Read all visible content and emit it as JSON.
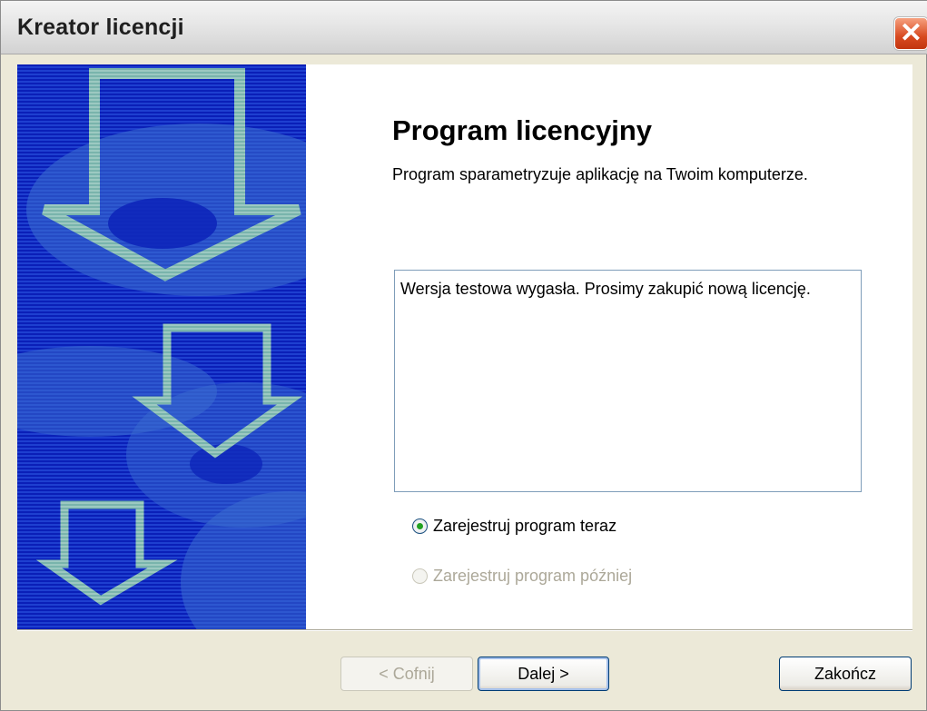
{
  "window": {
    "title": "Kreator licencji",
    "close_glyph": "✕"
  },
  "icons": {
    "close": "close-icon",
    "banner": "download-arrows-icon"
  },
  "page": {
    "heading": "Program licencyjny",
    "description": "Program sparametryzuje aplikację na Twoim komputerze.",
    "message": "Wersja testowa wygasła. Prosimy zakupić nową licencję."
  },
  "options": [
    {
      "label": "Zarejestruj program teraz",
      "selected": true,
      "enabled": true
    },
    {
      "label": "Zarejestruj program później",
      "selected": false,
      "enabled": false
    }
  ],
  "buttons": {
    "back": "< Cofnij",
    "next": "Dalej >",
    "finish": "Zakończ"
  },
  "colors": {
    "banner": "#0a1fb8",
    "arrow": "#79b4ac",
    "swirl": "#4f8bd6"
  }
}
